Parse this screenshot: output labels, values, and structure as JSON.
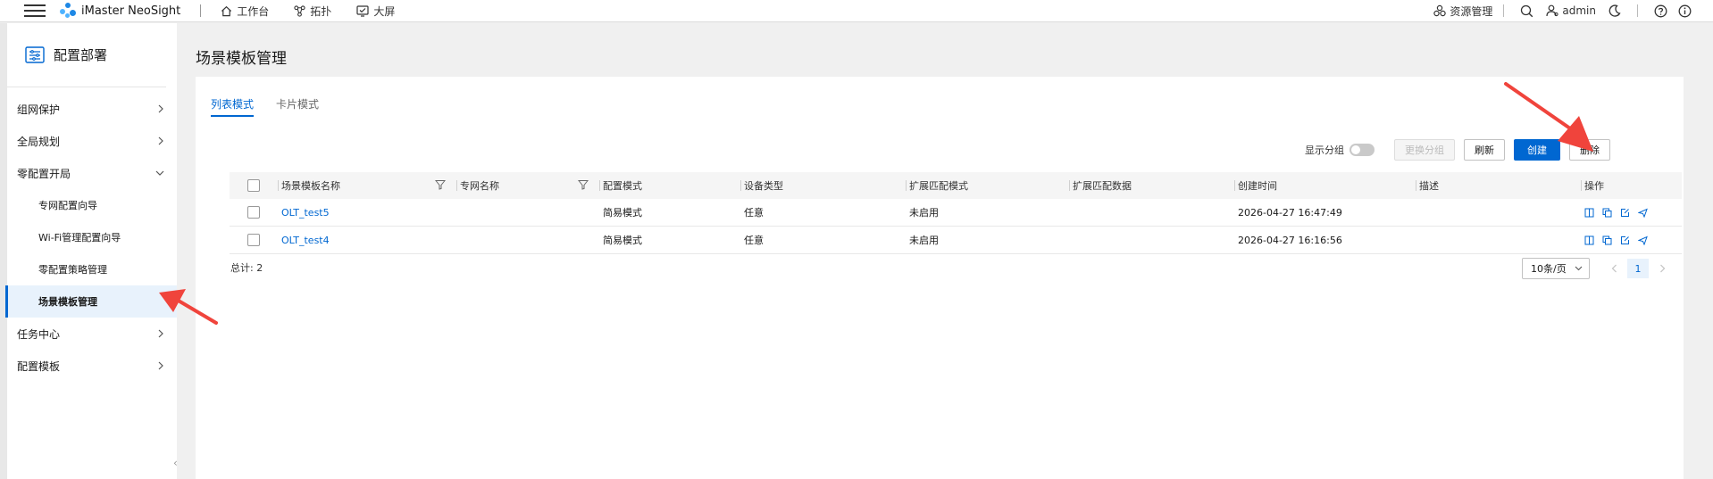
{
  "topbar": {
    "app_name": "iMaster NeoSight",
    "nav": [
      "工作台",
      "拓扑",
      "大屏"
    ],
    "resource_mgmt": "资源管理",
    "user": "admin"
  },
  "sidebar": {
    "title": "配置部署",
    "menu": [
      {
        "label": "组网保护"
      },
      {
        "label": "全局规划"
      },
      {
        "label": "零配置开局"
      },
      {
        "label": "任务中心"
      },
      {
        "label": "配置模板"
      }
    ],
    "sub": [
      "专网配置向导",
      "Wi-Fi管理配置向导",
      "零配置策略管理",
      "场景模板管理"
    ]
  },
  "page": {
    "title": "场景模板管理",
    "tabs": [
      "列表模式",
      "卡片模式"
    ]
  },
  "toolbar": {
    "show_group": "显示分组",
    "change_group": "更换分组",
    "refresh": "刷新",
    "create": "创建",
    "delete": "删除"
  },
  "table": {
    "columns": [
      "场景模板名称",
      "专网名称",
      "配置模式",
      "设备类型",
      "扩展匹配模式",
      "扩展匹配数据",
      "创建时间",
      "描述",
      "操作"
    ],
    "rows": [
      {
        "name": "OLT_test5",
        "network": "",
        "mode": "简易模式",
        "device": "任意",
        "ext_mode": "未启用",
        "ext_data": "",
        "time": "2026-04-27 16:47:49",
        "desc": ""
      },
      {
        "name": "OLT_test4",
        "network": "",
        "mode": "简易模式",
        "device": "任意",
        "ext_mode": "未启用",
        "ext_data": "",
        "time": "2026-04-27 16:16:56",
        "desc": ""
      }
    ]
  },
  "footer": {
    "total": "总计: 2",
    "page_size": "10条/页",
    "page": "1"
  },
  "colors": {
    "primary": "#0067d1",
    "annotation": "#f0443c"
  }
}
